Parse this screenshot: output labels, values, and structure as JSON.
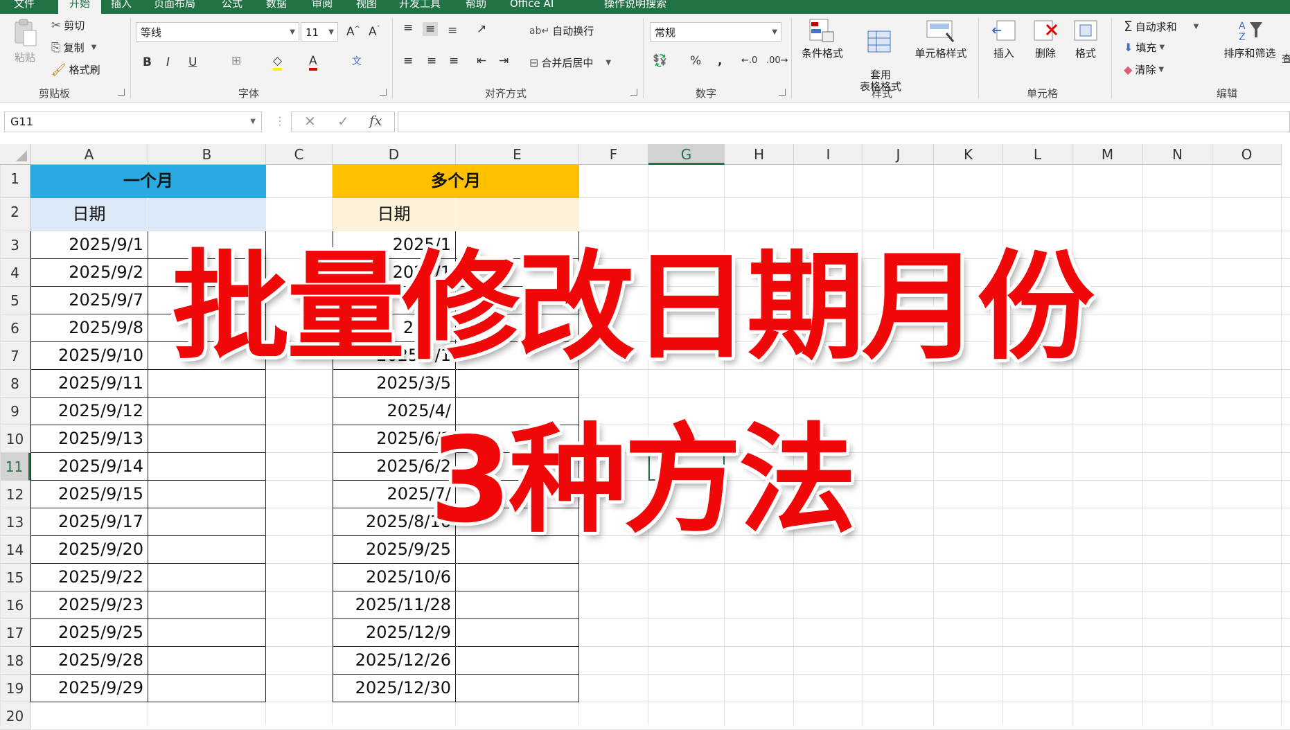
{
  "ribbon": {
    "tabs": [
      "文件",
      "开始",
      "插入",
      "页面布局",
      "公式",
      "数据",
      "审阅",
      "视图",
      "开发工具",
      "帮助",
      "Office AI",
      "操作说明搜索"
    ],
    "clipboard": {
      "paste": "粘贴",
      "cut": "剪切",
      "copy": "复制",
      "format_painter": "格式刷",
      "group": "剪贴板"
    },
    "font": {
      "name": "等线",
      "size": "11",
      "group": "字体"
    },
    "alignment": {
      "wrap": "自动换行",
      "merge": "合并后居中",
      "group": "对齐方式"
    },
    "number": {
      "format": "常规",
      "group": "数字"
    },
    "styles": {
      "conditional": "条件格式",
      "table": "套用\n表格格式",
      "cell": "单元格样式",
      "group": "样式"
    },
    "cells": {
      "insert": "插入",
      "delete": "删除",
      "format": "格式",
      "group": "单元格"
    },
    "editing": {
      "autosum": "自动求和",
      "fill": "填充",
      "clear": "清除",
      "sort": "排序和筛选",
      "find": "查",
      "group": "编辑"
    }
  },
  "formula_bar": {
    "name_box": "G11",
    "formula": ""
  },
  "sheet": {
    "columns": [
      "A",
      "B",
      "C",
      "D",
      "E",
      "F",
      "G",
      "H",
      "I",
      "J",
      "K",
      "L",
      "M",
      "N",
      "O"
    ],
    "selected_column": "G",
    "selected_row": "11",
    "rows": [
      "1",
      "2",
      "3",
      "4",
      "5",
      "6",
      "7",
      "8",
      "9",
      "10",
      "11",
      "12",
      "13",
      "14",
      "15",
      "16",
      "17",
      "18",
      "19",
      "20"
    ],
    "table1": {
      "title": "一个月",
      "title_color": "#29abe2",
      "header": "日期",
      "header_color": "#dbe9f6",
      "dates": [
        "2025/9/1",
        "2025/9/2",
        "2025/9/7",
        "2025/9/8",
        "2025/9/10",
        "2025/9/11",
        "2025/9/12",
        "2025/9/13",
        "2025/9/14",
        "2025/9/15",
        "2025/9/17",
        "2025/9/20",
        "2025/9/22",
        "2025/9/23",
        "2025/9/25",
        "2025/9/28",
        "2025/9/29"
      ]
    },
    "table2": {
      "title": "多个月",
      "title_color": "#ffc000",
      "header": "日期",
      "header_color": "#fdf1d8",
      "dates": [
        "2025/1",
        "2025/1",
        "2025",
        "2025/",
        "2025/3/1",
        "2025/3/5",
        "2025/4/",
        "2025/6/1",
        "2025/6/2",
        "2025/7/",
        "2025/8/16",
        "2025/9/25",
        "2025/10/6",
        "2025/11/28",
        "2025/12/9",
        "2025/12/26",
        "2025/12/30"
      ]
    }
  },
  "overlay": {
    "line1": "批量修改日期月份",
    "line2": "3种方法",
    "color": "#f00808"
  }
}
